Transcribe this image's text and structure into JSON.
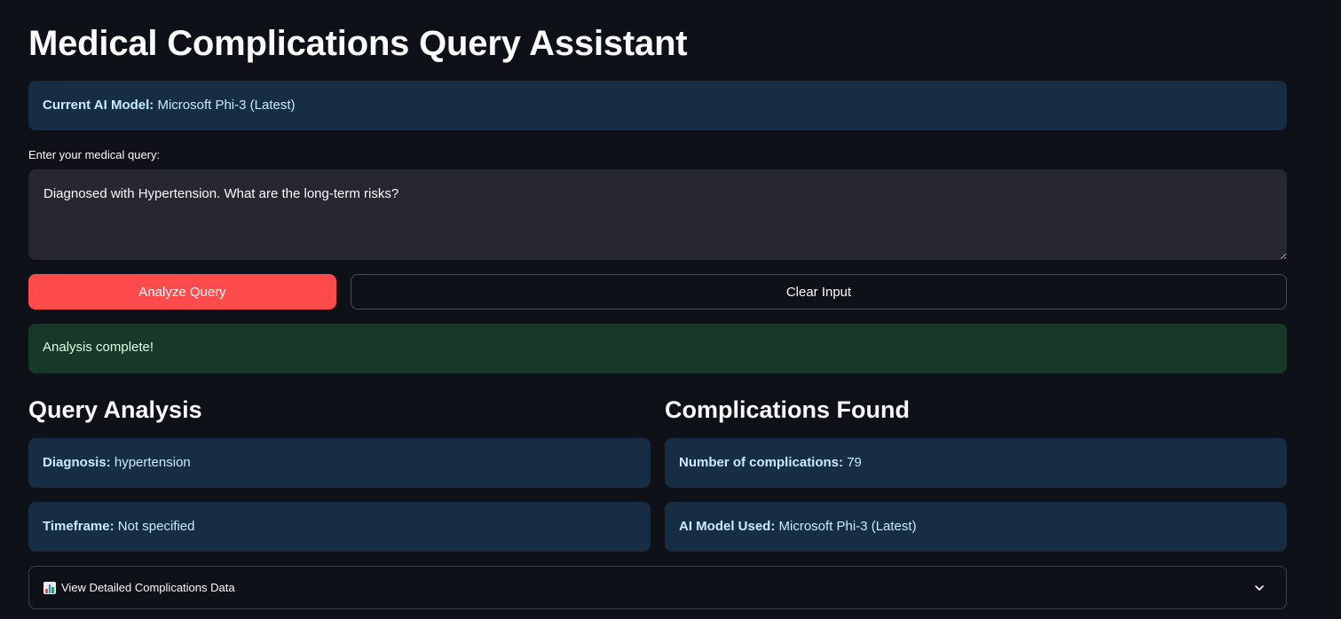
{
  "page": {
    "title": "Medical Complications Query Assistant"
  },
  "model_info": {
    "label": "Current AI Model:",
    "value": "Microsoft Phi-3 (Latest)"
  },
  "query": {
    "label": "Enter your medical query:",
    "value": "Diagnosed with Hypertension. What are the long-term risks?"
  },
  "buttons": {
    "analyze": "Analyze Query",
    "clear": "Clear Input"
  },
  "status": {
    "message": "Analysis complete!"
  },
  "query_analysis": {
    "heading": "Query Analysis",
    "diagnosis_label": "Diagnosis:",
    "diagnosis_value": "hypertension",
    "timeframe_label": "Timeframe:",
    "timeframe_value": "Not specified"
  },
  "complications": {
    "heading": "Complications Found",
    "count_label": "Number of complications:",
    "count_value": "79",
    "model_label": "AI Model Used:",
    "model_value": "Microsoft Phi-3 (Latest)"
  },
  "expander": {
    "icon": "bar-chart-icon",
    "label": "View Detailed Complications Data"
  },
  "colors": {
    "background": "#0e1117",
    "primary": "#ff4b4b",
    "info_bg": "#172d43",
    "success_bg": "#173928"
  }
}
